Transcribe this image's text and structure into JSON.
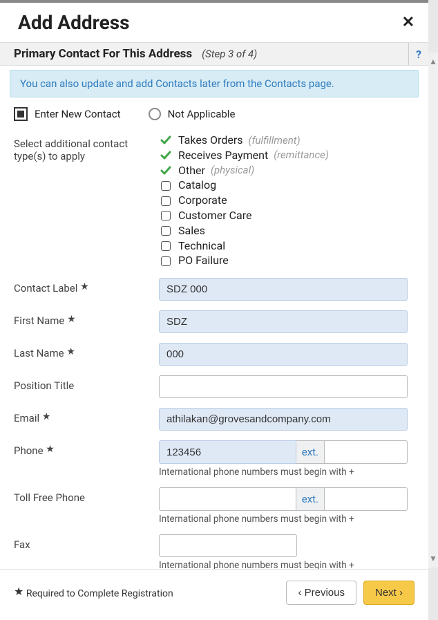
{
  "header": {
    "title": "Add Address"
  },
  "section": {
    "title": "Primary Contact For This Address",
    "step": "(Step 3 of 4)",
    "help": "?"
  },
  "banner": "You can also update and add Contacts later from the Contacts page.",
  "radios": {
    "enter_new": "Enter New Contact",
    "not_applicable": "Not Applicable"
  },
  "types": {
    "label": "Select additional contact type(s) to apply",
    "items": [
      {
        "name": "Takes Orders",
        "note": "(fulfillment)",
        "checked": true
      },
      {
        "name": "Receives Payment",
        "note": "(remittance)",
        "checked": true
      },
      {
        "name": "Other",
        "note": "(physical)",
        "checked": true
      },
      {
        "name": "Catalog",
        "note": "",
        "checked": false
      },
      {
        "name": "Corporate",
        "note": "",
        "checked": false
      },
      {
        "name": "Customer Care",
        "note": "",
        "checked": false
      },
      {
        "name": "Sales",
        "note": "",
        "checked": false
      },
      {
        "name": "Technical",
        "note": "",
        "checked": false
      },
      {
        "name": "PO Failure",
        "note": "",
        "checked": false
      }
    ]
  },
  "fields": {
    "contact_label": {
      "label": "Contact Label",
      "value": "SDZ 000",
      "required": true
    },
    "first_name": {
      "label": "First Name",
      "value": "SDZ",
      "required": true
    },
    "last_name": {
      "label": "Last Name",
      "value": "000",
      "required": true
    },
    "position_title": {
      "label": "Position Title",
      "value": "",
      "required": false
    },
    "email": {
      "label": "Email",
      "value": "athilakan@grovesandcompany.com",
      "required": true
    },
    "phone": {
      "label": "Phone",
      "value": "123456",
      "required": true,
      "ext_label": "ext.",
      "ext_value": "",
      "helper": "International phone numbers must begin with +"
    },
    "toll_free": {
      "label": "Toll Free Phone",
      "value": "",
      "required": false,
      "ext_label": "ext.",
      "ext_value": "",
      "helper": "International phone numbers must begin with +"
    },
    "fax": {
      "label": "Fax",
      "value": "",
      "required": false,
      "helper": "International phone numbers must begin with +"
    }
  },
  "footer": {
    "required_note": "Required to Complete Registration",
    "previous": "Previous",
    "next": "Next"
  }
}
